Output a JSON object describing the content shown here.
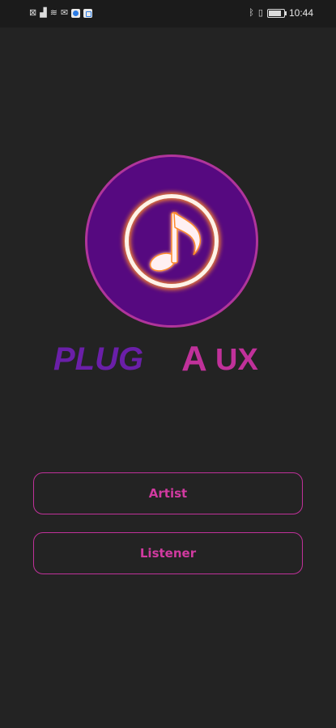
{
  "status_bar": {
    "time": "10:44",
    "left_icons": [
      "sim-icon",
      "signal-icon",
      "wifi-icon",
      "mail-icon",
      "app-icon-blue",
      "app-icon-square"
    ],
    "right_icons": [
      "bluetooth-icon",
      "vibrate-icon",
      "battery-icon"
    ]
  },
  "logo": {
    "wordmark": "PLUGAUX",
    "wordmark_parts": [
      "PLUG",
      "A",
      "UX"
    ],
    "circle_color": "#560980",
    "border_color": "#b0359b",
    "glow_color": "#ff8a2a"
  },
  "buttons": {
    "artist_label": "Artist",
    "listener_label": "Listener",
    "accent_color": "#c0319a"
  }
}
